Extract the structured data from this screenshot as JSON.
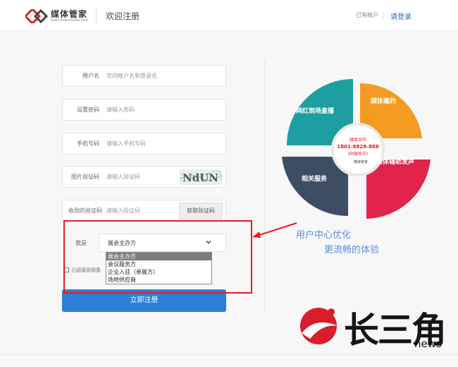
{
  "header": {
    "brand_name": "媒体管家",
    "brand_sub": "www.zhaomedia.com",
    "title": "欢迎注册",
    "have_account": "已有帐户",
    "separator": "|",
    "login_link": "请登录"
  },
  "form": {
    "username": {
      "label": "用户名",
      "placeholder": "您的帐户名和登录名"
    },
    "password": {
      "label": "设置密码",
      "placeholder": "请输入密码"
    },
    "phone": {
      "label": "手机号码",
      "placeholder": "请输入手机号码"
    },
    "image_code": {
      "label": "图片验证码",
      "placeholder": "请输入验证码",
      "captcha_text": "NdUN"
    },
    "sms_code": {
      "label": "收到的验证码",
      "placeholder": "请输入验证码",
      "button": "获取验证码"
    },
    "role": {
      "label": "我是",
      "selected": "展会主办方",
      "options": [
        "展会主办方",
        "会议服务方",
        "企业入驻（参展方）",
        "场地供应商"
      ]
    },
    "agree_text": "已阅读并同意",
    "submit": "立即注册"
  },
  "promo": {
    "segments": [
      {
        "title": "网红到场直播",
        "color": "#1e9ea0"
      },
      {
        "title": "媒体邀约",
        "color": "#f59a23"
      },
      {
        "title": "媒体辅助发声",
        "color": "#e0244b"
      },
      {
        "title": "相关服务",
        "color": "#3d4e63"
      }
    ],
    "center_line1": "媒体合作",
    "center_phone": "1801-8828-868",
    "center_line3": "(同微信号)",
    "center_brand": "媒体管家",
    "tagline1": "用户中心优化",
    "tagline2": "更流畅的体验"
  },
  "watermark": {
    "text": "长三角",
    "sub": "news"
  },
  "colors": {
    "primary": "#2e7fd8",
    "highlight": "#e41b23",
    "link": "#2c6db5"
  }
}
